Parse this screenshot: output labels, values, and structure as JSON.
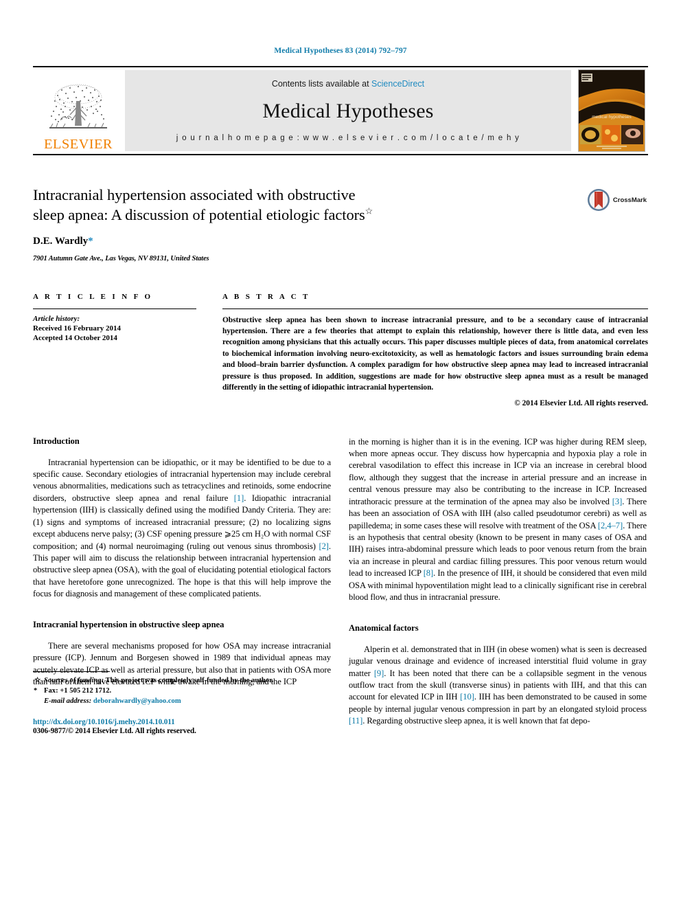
{
  "running_head": "Medical Hypotheses 83 (2014) 792–797",
  "masthead": {
    "publisher_name": "ELSEVIER",
    "contents_prefix": "Contents lists available at ",
    "contents_link": "ScienceDirect",
    "journal_title": "Medical Hypotheses",
    "homepage": "j o u r n a l   h o m e p a g e :   w w w . e l s e v i e r . c o m / l o c a t e / m e h y",
    "cover_caption": "medical hypotheses"
  },
  "title_block": {
    "title_line1": "Intracranial hypertension associated with obstructive",
    "title_line2": "sleep apnea: A discussion of potential etiologic factors",
    "title_footnote_mark": "☆",
    "author": "D.E. Wardly",
    "author_mark": "*",
    "affiliation": "7901 Autumn Gate Ave., Las Vegas, NV 89131, United States",
    "crossmark_label": "CrossMark"
  },
  "article_info": {
    "label": "A R T I C L E   I N F O",
    "history_label": "Article history:",
    "received": "Received 16 February 2014",
    "accepted": "Accepted 14 October 2014"
  },
  "abstract": {
    "label": "A B S T R A C T",
    "text": "Obstructive sleep apnea has been shown to increase intracranial pressure, and to be a secondary cause of intracranial hypertension. There are a few theories that attempt to explain this relationship, however there is little data, and even less recognition among physicians that this actually occurs. This paper discusses multiple pieces of data, from anatomical correlates to biochemical information involving neuro-excitotoxicity, as well as hematologic factors and issues surrounding brain edema and blood–brain barrier dysfunction. A complex paradigm for how obstructive sleep apnea may lead to increased intracranial pressure is thus proposed. In addition, suggestions are made for how obstructive sleep apnea must as a result be managed differently in the setting of idiopathic intracranial hypertension.",
    "copyright": "© 2014 Elsevier Ltd. All rights reserved."
  },
  "body": {
    "left": {
      "heading_1": "Introduction",
      "para_1a": "Intracranial hypertension can be idiopathic, or it may be identified to be due to a specific cause. Secondary etiologies of intracranial hypertension may include cerebral venous abnormalities, medications such as tetracyclines and retinoids, some endocrine disorders, obstructive sleep apnea and renal failure ",
      "ref_1": "[1]",
      "para_1b": ". Idiopathic intracranial hypertension (IIH) is classically defined using the modified Dandy Criteria. They are: (1) signs and symptoms of increased intracranial pressure; (2) no localizing signs except abducens nerve palsy; (3) CSF opening pressure ⩾25 cm H₂O with normal CSF composition; and (4) normal neuroimaging (ruling out venous sinus thrombosis) ",
      "ref_2": "[2]",
      "para_1c": ". This paper will aim to discuss the relationship between intracranial hypertension and obstructive sleep apnea (OSA), with the goal of elucidating potential etiological factors that have heretofore gone unrecognized. The hope is that this will help improve the focus for diagnosis and management of these complicated patients.",
      "heading_2": "Intracranial hypertension in obstructive sleep apnea",
      "para_2": "There are several mechanisms proposed for how OSA may increase intracranial pressure (ICP). Jennum and Borgesen showed in 1989 that individual apneas may acutely elevate ICP as well as arterial pressure, but also that in patients with OSA more than half of them have elevated ICP while awake in the morning, and the ICP"
    },
    "right": {
      "para_3a": "in the morning is higher than it is in the evening. ICP was higher during REM sleep, when more apneas occur. They discuss how hypercapnia and hypoxia play a role in cerebral vasodilation to effect this increase in ICP via an increase in cerebral blood flow, although they suggest that the increase in arterial pressure and an increase in central venous pressure may also be contributing to the increase in ICP. Increased intrathoracic pressure at the termination of the apnea may also be involved ",
      "ref_3": "[3]",
      "para_3b": ". There has been an association of OSA with IIH (also called pseudotumor cerebri) as well as papilledema; in some cases these will resolve with treatment of the OSA ",
      "ref_4": "[2,4–7]",
      "para_3c": ". There is an hypothesis that central obesity (known to be present in many cases of OSA and IIH) raises intra-abdominal pressure which leads to poor venous return from the brain via an increase in pleural and cardiac filling pressures. This poor venous return would lead to increased ICP ",
      "ref_5": "[8]",
      "para_3d": ". In the presence of IIH, it should be considered that even mild OSA with minimal hypoventilation might lead to a clinically significant rise in cerebral blood flow, and thus in intracranial pressure.",
      "heading_3": "Anatomical factors",
      "para_4a": "Alperin et al. demonstrated that in IIH (in obese women) what is seen is decreased jugular venous drainage and evidence of increased interstitial fluid volume in gray matter ",
      "ref_6": "[9]",
      "para_4b": ". It has been noted that there can be a collapsible segment in the venous outflow tract from the skull (transverse sinus) in patients with IIH, and that this can account for elevated ICP in IIH ",
      "ref_7": "[10]",
      "para_4c": ". IIH has been demonstrated to be caused in some people by internal jugular venous compression in part by an elongated styloid process ",
      "ref_8": "[11]",
      "para_4d": ". Regarding obstructive sleep apnea, it is well known that fat depo-"
    }
  },
  "footnotes": {
    "funding_mark": "☆",
    "funding_label": "Sources of funding:",
    "funding_text": " This project was completely self-funded by the author.",
    "fax_mark": "*",
    "fax_text": "Fax: +1 505 212 1712.",
    "email_label": "E-mail address:",
    "email": "deborahwardly@yahoo.com",
    "doi": "http://dx.doi.org/10.1016/j.mehy.2014.10.011",
    "issn": "0306-9877/© 2014 Elsevier Ltd. All rights reserved."
  },
  "colors": {
    "link_blue": "#0f7ca8",
    "sciencedirect_blue": "#1f8ac0",
    "elsevier_orange": "#f08000",
    "masthead_gray": "#e6e6e6"
  }
}
